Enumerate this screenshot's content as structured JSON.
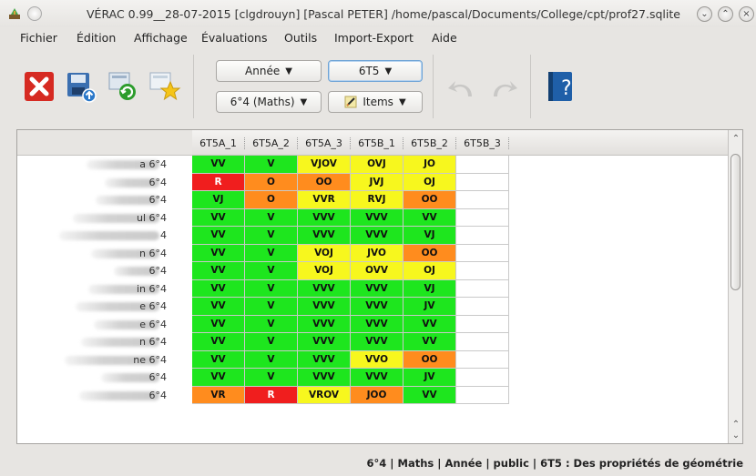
{
  "titlebar": {
    "title": "VÉRAC 0.99__28-07-2015 [clgdrouyn] [Pascal PETER] /home/pascal/Documents/College/cpt/prof27.sqlite",
    "buttons": [
      "⌄",
      "⌃",
      "×"
    ]
  },
  "menu": [
    "Fichier",
    "Édition",
    "Affichage",
    "Évaluations",
    "Outils",
    "Import-Export",
    "Aide"
  ],
  "toolbar": {
    "period_combo": "Année",
    "group_combo": "6°4 (Maths)",
    "sequence_combo": "6T5",
    "items_combo": "Items",
    "help_label": "?"
  },
  "grid": {
    "columns": [
      "6T5A_1",
      "6T5A_2",
      "6T5A_3",
      "6T5B_1",
      "6T5B_2",
      "6T5B_3"
    ],
    "rows": [
      {
        "suffix": "a 6°4",
        "values": [
          "VV",
          "V",
          "VJOV",
          "OVJ",
          "JO",
          ""
        ]
      },
      {
        "suffix": "6°4",
        "values": [
          "R",
          "O",
          "OO",
          "JVJ",
          "OJ",
          ""
        ]
      },
      {
        "suffix": "6°4",
        "values": [
          "VJ",
          "O",
          "VVR",
          "RVJ",
          "OO",
          ""
        ]
      },
      {
        "suffix": "ul 6°4",
        "values": [
          "VV",
          "V",
          "VVV",
          "VVV",
          "VV",
          ""
        ]
      },
      {
        "suffix": "4",
        "values": [
          "VV",
          "V",
          "VVV",
          "VVV",
          "VJ",
          ""
        ]
      },
      {
        "suffix": "n 6°4",
        "values": [
          "VV",
          "V",
          "VOJ",
          "JVO",
          "OO",
          ""
        ]
      },
      {
        "suffix": "6°4",
        "values": [
          "VV",
          "V",
          "VOJ",
          "OVV",
          "OJ",
          ""
        ]
      },
      {
        "suffix": "in 6°4",
        "values": [
          "VV",
          "V",
          "VVV",
          "VVV",
          "VJ",
          ""
        ]
      },
      {
        "suffix": "e 6°4",
        "values": [
          "VV",
          "V",
          "VVV",
          "VVV",
          "JV",
          ""
        ]
      },
      {
        "suffix": "e 6°4",
        "values": [
          "VV",
          "V",
          "VVV",
          "VVV",
          "VV",
          ""
        ]
      },
      {
        "suffix": "n 6°4",
        "values": [
          "VV",
          "V",
          "VVV",
          "VVV",
          "VV",
          ""
        ]
      },
      {
        "suffix": "ne 6°4",
        "values": [
          "VV",
          "V",
          "VVV",
          "VVO",
          "OO",
          ""
        ]
      },
      {
        "suffix": "6°4",
        "values": [
          "VV",
          "V",
          "VVV",
          "VVV",
          "JV",
          ""
        ]
      },
      {
        "suffix": "6°4",
        "values": [
          "VR",
          "R",
          "VROV",
          "JOO",
          "VV",
          ""
        ]
      }
    ]
  },
  "colors": {
    "green": "#1ee61e",
    "yellow": "#f7f71e",
    "orange": "#ff8c1e",
    "red": "#f01e1e",
    "empty": "#ffffff"
  },
  "status": "6°4 | Maths | Année | public | 6T5 : Des propriétés de géométrie"
}
